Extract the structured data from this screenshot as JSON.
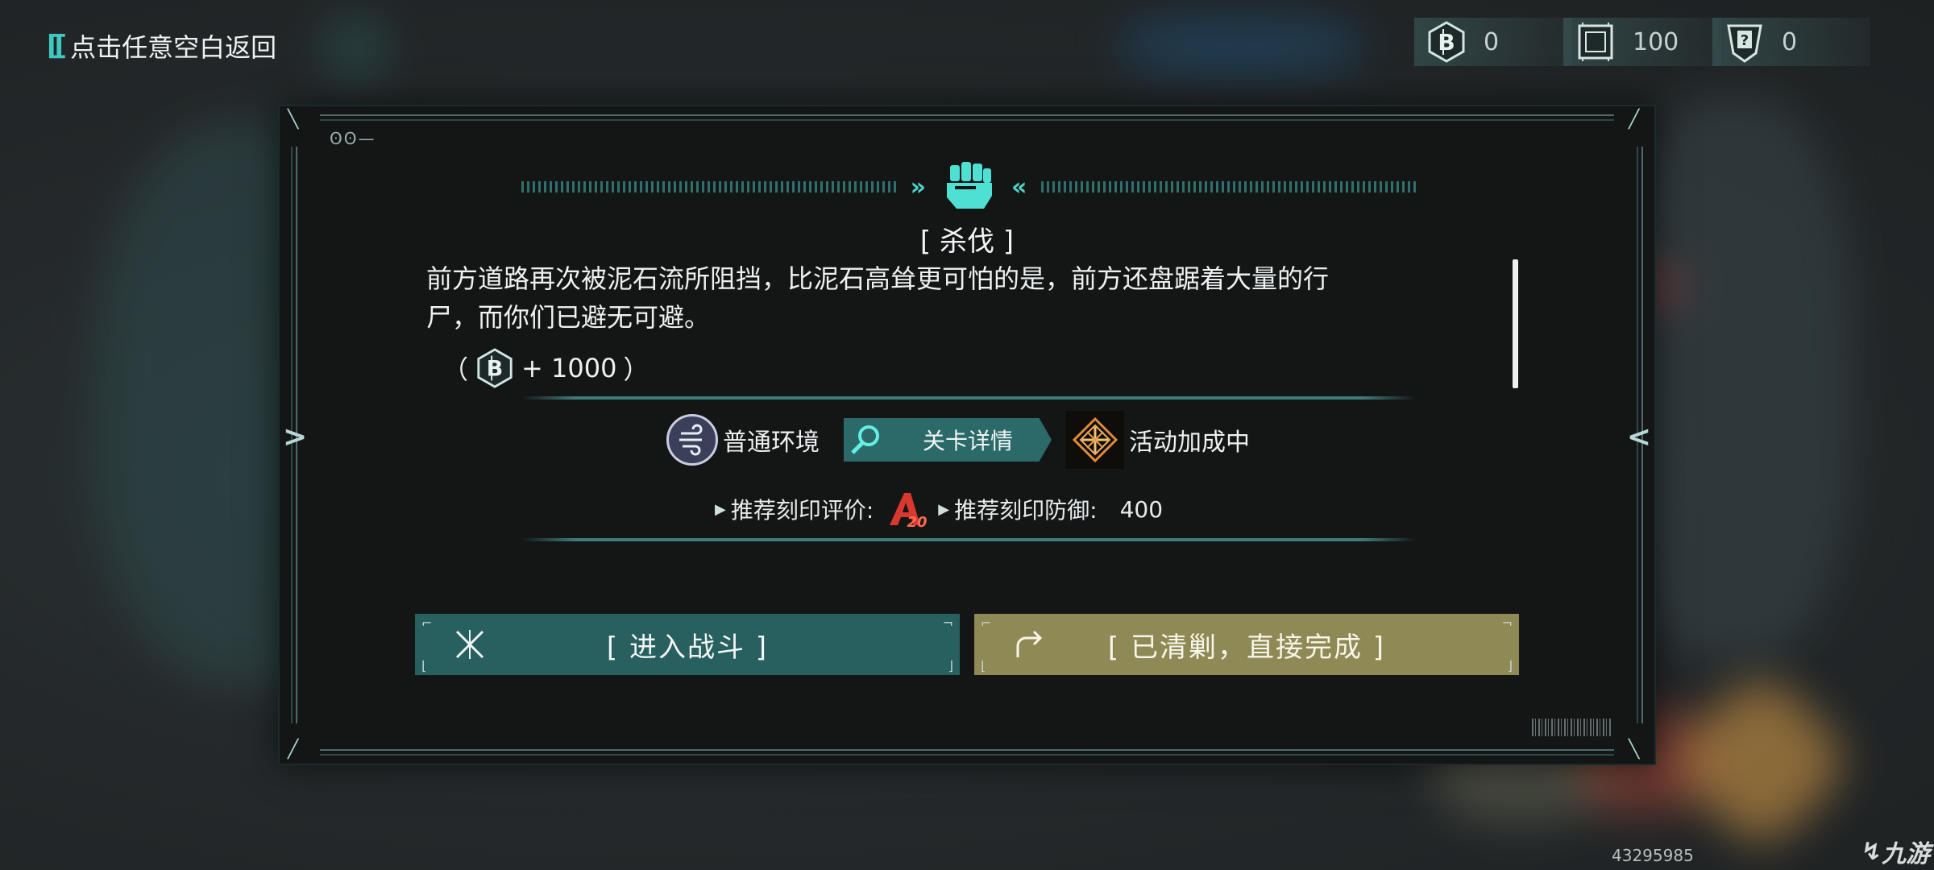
{
  "top_bar": {
    "back_label": "点击任意空白返回",
    "currencies": [
      {
        "icon": "b-coin-icon",
        "value": "0"
      },
      {
        "icon": "chip-icon",
        "value": "100"
      },
      {
        "icon": "question-card-icon",
        "value": "0"
      }
    ]
  },
  "dialog": {
    "title": "[ 杀伐 ]",
    "description": "前方道路再次被泥石流所阻挡，比泥石高耸更可怕的是，前方还盘踞着大量的行尸，而你们已避无可避。",
    "reward": {
      "open": "（",
      "amount": "+ 1000",
      "close": "）",
      "icon": "b-coin-icon"
    },
    "environment_label": "普通环境",
    "details_label": "关卡详情",
    "bonus_label": "活动加成中",
    "recommend_rating_label": "推荐刻印评价:",
    "recommend_rating_badge": "A20",
    "recommend_defense_label": "推荐刻印防御:",
    "recommend_defense_value": "400",
    "enter_battle_label": "[ 进入战斗 ]",
    "auto_complete_label": "[ 已清剿，直接完成 ]",
    "dots": "ʘʘ—"
  },
  "watermark": {
    "id": "43295985",
    "logo": "九游"
  },
  "colors": {
    "accent": "#3ec8c0",
    "fight_button": "#28605f",
    "complete_button": "#8f8a55",
    "panel": "#141616"
  }
}
